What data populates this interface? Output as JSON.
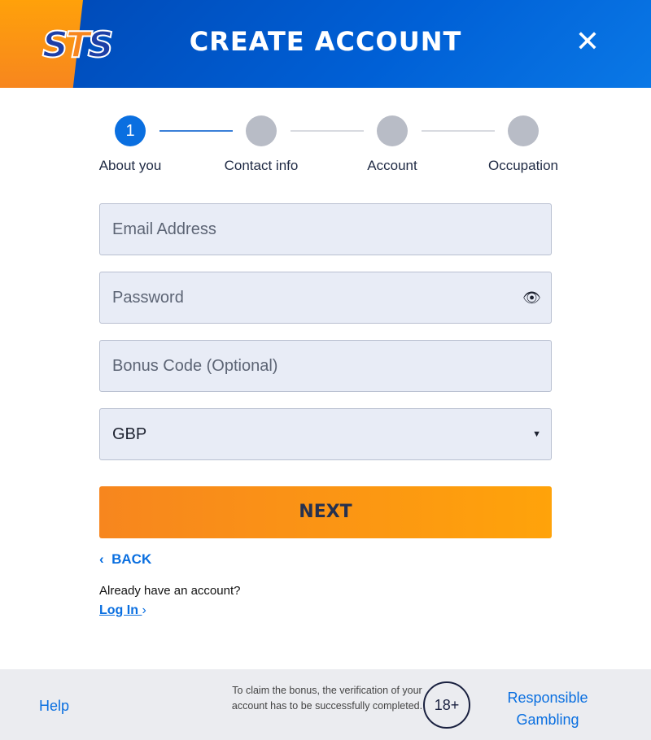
{
  "header": {
    "logo": "STS",
    "title": "CREATE ACCOUNT",
    "close_icon": "close-icon"
  },
  "steps": [
    {
      "number": "1",
      "label": "About you",
      "active": true
    },
    {
      "number": "",
      "label": "Contact info",
      "active": false
    },
    {
      "number": "",
      "label": "Account",
      "active": false
    },
    {
      "number": "",
      "label": "Occupation",
      "active": false
    }
  ],
  "form": {
    "email_placeholder": "Email Address",
    "password_placeholder": "Password",
    "bonus_placeholder": "Bonus Code (Optional)",
    "currency_value": "GBP",
    "next_label": "NEXT",
    "back_label": "BACK",
    "already_text": "Already have an account?",
    "login_label": "Log In"
  },
  "footer": {
    "help": "Help",
    "notice": "To claim the bonus, the verification of your account has to be successfully completed.",
    "age_badge": "18+",
    "responsible": "Responsible Gambling"
  },
  "colors": {
    "brand_blue": "#0060d6",
    "brand_orange": "#f7861e",
    "link": "#0a6fe0"
  }
}
